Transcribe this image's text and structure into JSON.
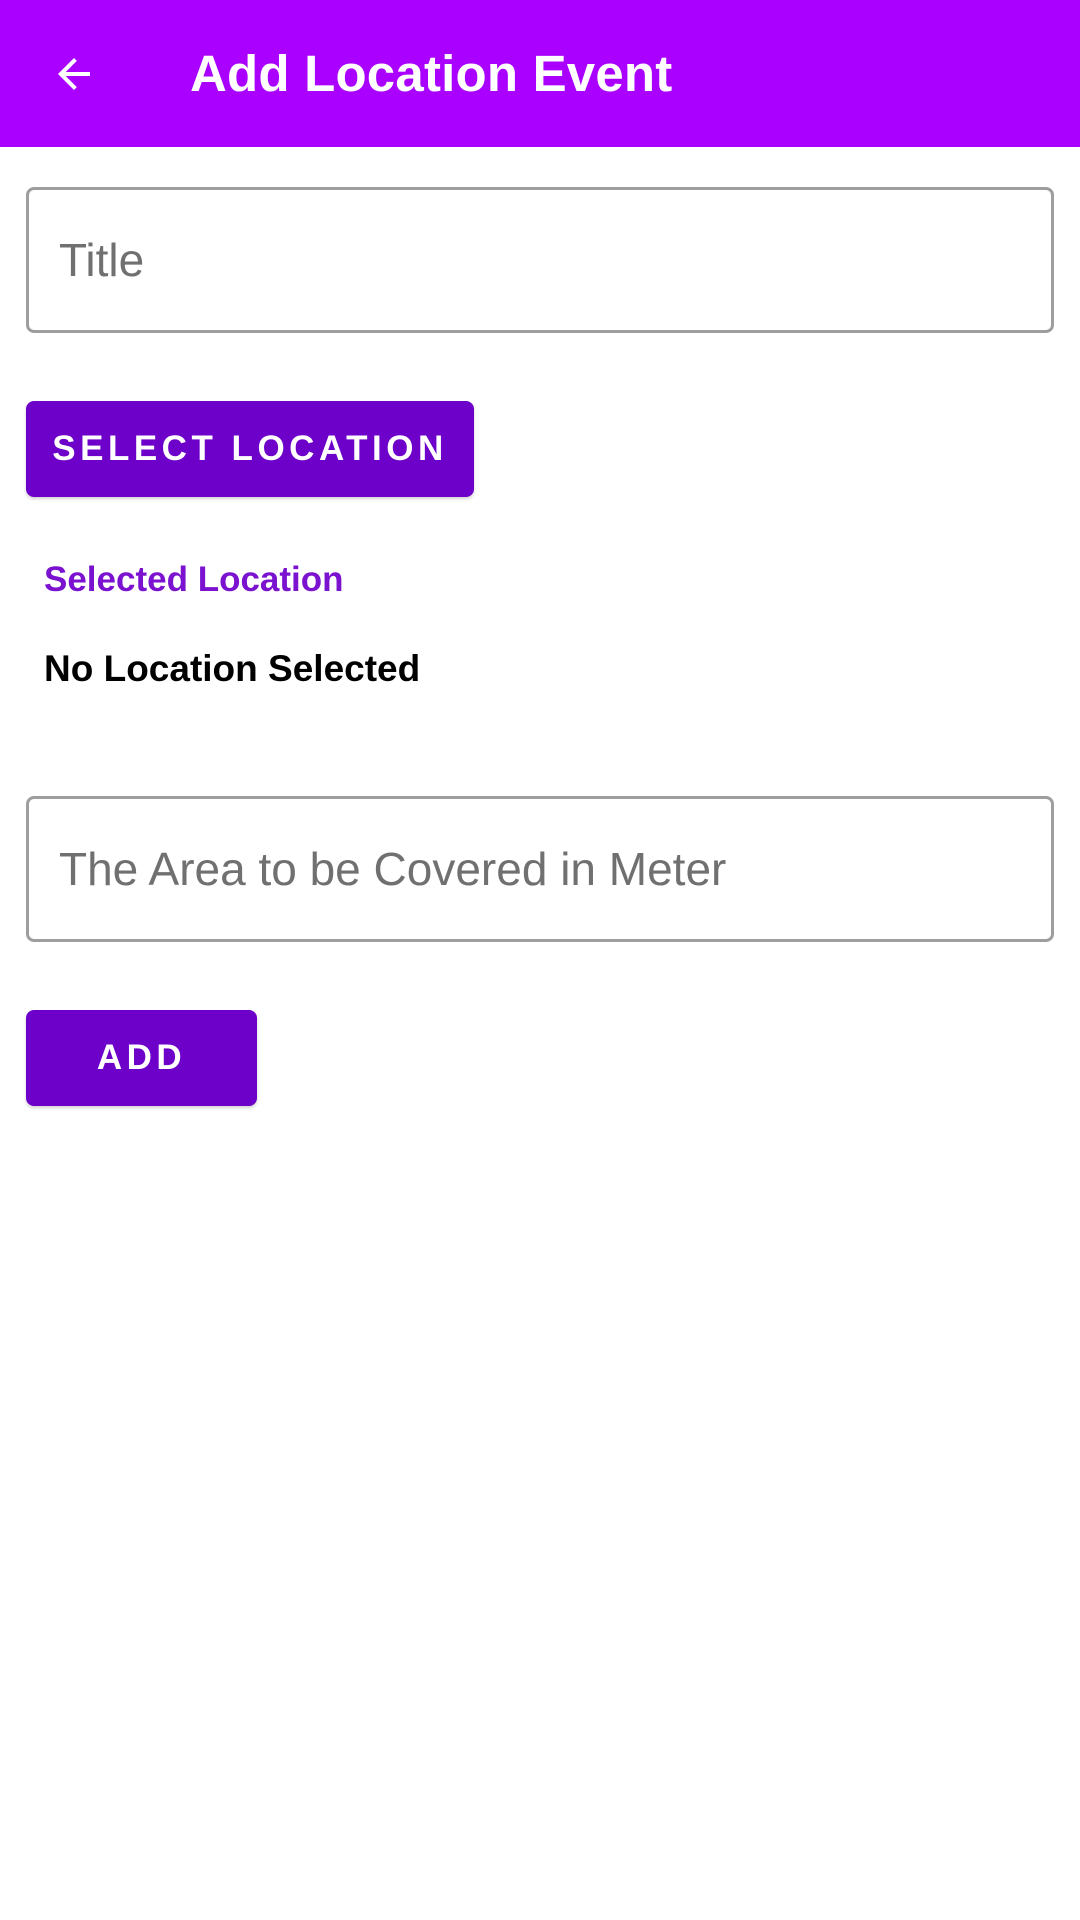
{
  "app_bar": {
    "title": "Add Location Event",
    "back_icon": "arrow-left-icon",
    "color": "#aa00ff"
  },
  "form": {
    "title_field": {
      "placeholder": "Title",
      "value": ""
    },
    "select_location_button": {
      "label": "SELECT LOCATION"
    },
    "selected_location": {
      "label": "Selected Location",
      "value": "No Location Selected"
    },
    "area_field": {
      "placeholder": "The Area to be Covered in Meter",
      "value": ""
    },
    "add_button": {
      "label": "ADD"
    }
  },
  "colors": {
    "accent": "#aa00ff",
    "button": "#6d00c9",
    "section_label": "#7b12cf",
    "field_border": "#9e9e9e"
  }
}
